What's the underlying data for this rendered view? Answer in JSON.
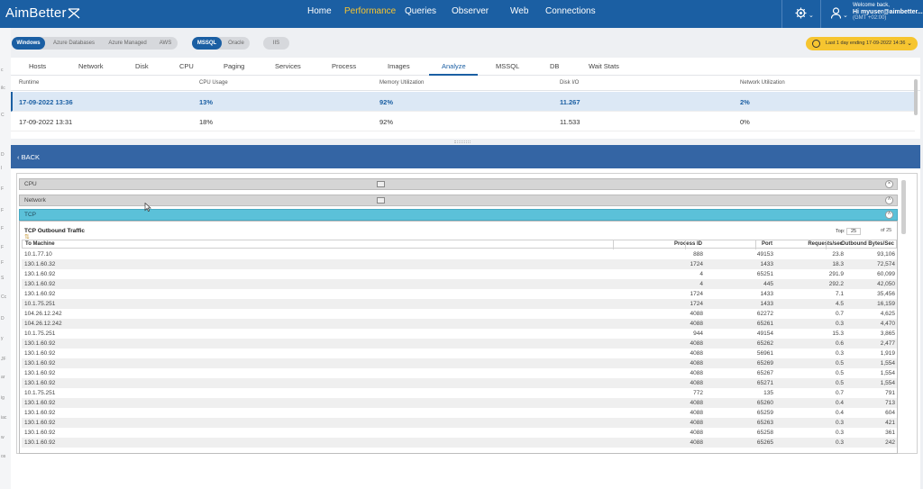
{
  "brand": {
    "name": "AimBetter"
  },
  "nav": [
    {
      "label": "Home",
      "active": false
    },
    {
      "label": "Performance",
      "active": true
    },
    {
      "label": "Queries",
      "active": false
    },
    {
      "label": "Observer",
      "active": false
    },
    {
      "label": "Web",
      "active": false
    },
    {
      "label": "Connections",
      "active": false
    }
  ],
  "header": {
    "settings_icon": "gear-icon",
    "user_icon": "user-icon",
    "welcome": "Welcome back,",
    "user": "Hi myuser@aimbetter...",
    "timezone": "(GMT +02:00)"
  },
  "left_marks": [
    "c",
    "ilc",
    "C",
    "D",
    "I",
    "F",
    "F",
    "F",
    "F",
    "F",
    "S",
    "Cc",
    "D",
    "y",
    "JF",
    "ar",
    "ig",
    "iac",
    "w",
    "os"
  ],
  "platform_pills": [
    "Windows",
    "Azure Databases",
    "Azure Managed",
    "AWS"
  ],
  "db_pills": [
    "MSSQL",
    "Oracle"
  ],
  "iis_pill": "IIS",
  "time_range": "Last 1 day ending  17-09-2022 14:36",
  "tabs": [
    "Hosts",
    "Network",
    "Disk",
    "CPU",
    "Paging",
    "Services",
    "Process",
    "Images",
    "Analyze",
    "MSSQL",
    "DB",
    "Wait Stats"
  ],
  "active_tab": "Analyze",
  "runtime_grid": {
    "headers": [
      "Runtime",
      "CPU Usage",
      "Memory Utilization",
      "Disk I/O",
      "Network Utilization"
    ],
    "rows": [
      [
        "17-09-2022 13:36",
        "13%",
        "92%",
        "11.267",
        "2%"
      ],
      [
        "17-09-2022 13:31",
        "18%",
        "92%",
        "11.533",
        "0%"
      ]
    ]
  },
  "back_label": "BACK",
  "sections": [
    "CPU",
    "Network",
    "TCP"
  ],
  "tcp_table": {
    "title": "TCP Outbound Traffic",
    "top_label": "Top:",
    "top_value": "25",
    "of_label": "of 25",
    "headers": [
      "To Machine",
      "Process ID",
      "Port",
      "Requests/sec",
      "Outbound Bytes/Sec"
    ],
    "rows": [
      [
        "10.1.77.10",
        "888",
        "49153",
        "23.8",
        "93,106"
      ],
      [
        "130.1.60.32",
        "1724",
        "1433",
        "18.3",
        "72,574"
      ],
      [
        "130.1.60.92",
        "4",
        "65251",
        "291.9",
        "60,099"
      ],
      [
        "130.1.60.92",
        "4",
        "445",
        "292.2",
        "42,050"
      ],
      [
        "130.1.60.92",
        "1724",
        "1433",
        "7.1",
        "35,456"
      ],
      [
        "10.1.75.251",
        "1724",
        "1433",
        "4.5",
        "16,159"
      ],
      [
        "104.26.12.242",
        "4088",
        "62272",
        "0.7",
        "4,625"
      ],
      [
        "104.26.12.242",
        "4088",
        "65261",
        "0.3",
        "4,470"
      ],
      [
        "10.1.75.251",
        "944",
        "49154",
        "15.3",
        "3,865"
      ],
      [
        "130.1.60.92",
        "4088",
        "65262",
        "0.6",
        "2,477"
      ],
      [
        "130.1.60.92",
        "4088",
        "56961",
        "0.3",
        "1,919"
      ],
      [
        "130.1.60.92",
        "4088",
        "65269",
        "0.5",
        "1,554"
      ],
      [
        "130.1.60.92",
        "4088",
        "65267",
        "0.5",
        "1,554"
      ],
      [
        "130.1.60.92",
        "4088",
        "65271",
        "0.5",
        "1,554"
      ],
      [
        "10.1.75.251",
        "772",
        "135",
        "0.7",
        "791"
      ],
      [
        "130.1.60.92",
        "4088",
        "65260",
        "0.4",
        "713"
      ],
      [
        "130.1.60.92",
        "4088",
        "65259",
        "0.4",
        "604"
      ],
      [
        "130.1.60.92",
        "4088",
        "65263",
        "0.3",
        "421"
      ],
      [
        "130.1.60.92",
        "4088",
        "65258",
        "0.3",
        "361"
      ],
      [
        "130.1.60.92",
        "4088",
        "65265",
        "0.3",
        "242"
      ]
    ]
  }
}
